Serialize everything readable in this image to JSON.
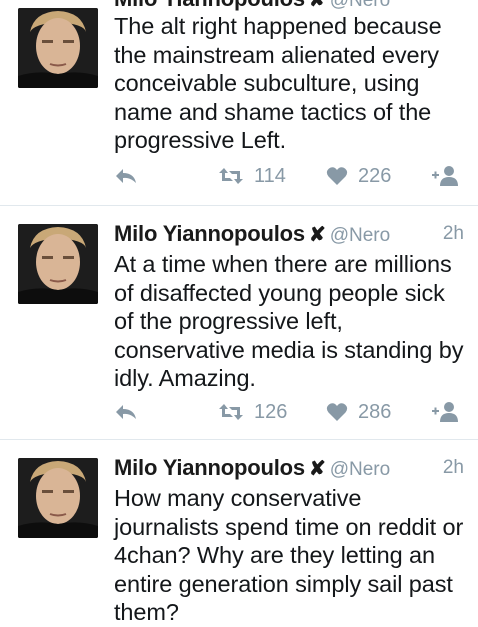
{
  "colors": {
    "text": "#14171a",
    "meta": "#8899a6",
    "divider": "#e1e8ed"
  },
  "tweets": [
    {
      "name": "Milo Yiannopoulos",
      "badge": "✘",
      "handle": "@Nero",
      "time": "",
      "text": "The alt right happened because the mainstream alienated every conceivable subculture, using name and shame tactics of the progressive Left.",
      "retweets": "114",
      "likes": "226"
    },
    {
      "name": "Milo Yiannopoulos",
      "badge": "✘",
      "handle": "@Nero",
      "time": "2h",
      "text": "At a time when there are millions of disaffected young people sick of the progressive left, conservative media is standing by idly. Amazing.",
      "retweets": "126",
      "likes": "286"
    },
    {
      "name": "Milo Yiannopoulos",
      "badge": "✘",
      "handle": "@Nero",
      "time": "2h",
      "text": "How many conservative journalists spend time on reddit or 4chan? Why are they letting an entire generation simply sail past them?",
      "retweets": "",
      "likes": ""
    }
  ],
  "icons": {
    "reply": "reply-icon",
    "retweet": "retweet-icon",
    "like": "heart-icon",
    "follow": "follow-user-icon"
  }
}
